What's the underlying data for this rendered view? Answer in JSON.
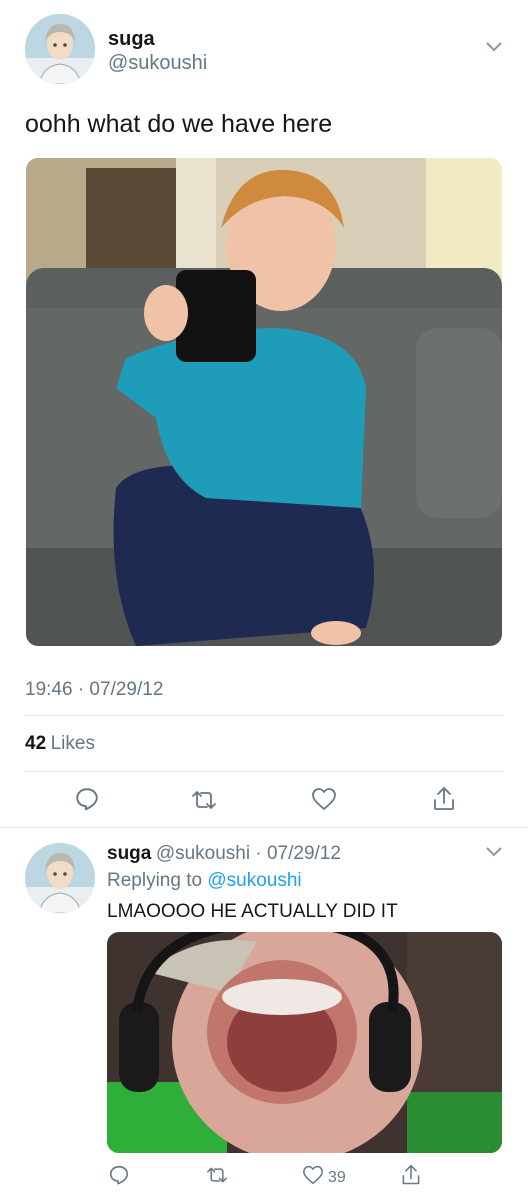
{
  "main_tweet": {
    "display_name": "suga",
    "handle": "@sukoushi",
    "text": "oohh what do we have here",
    "timestamp": "19:46 · 07/29/12",
    "likes_count": "42",
    "likes_label": "Likes",
    "photo_alt": "kid-with-mug-photo"
  },
  "reply_tweet": {
    "display_name": "suga",
    "handle": "@sukoushi",
    "date": "07/29/12",
    "replying_prefix": "Replying to",
    "replying_to": "@sukoushi",
    "text": "LMAOOOO HE ACTUALLY DID IT",
    "like_count": "39",
    "photo_alt": "screaming-face-photo"
  },
  "icons": [
    "avatar",
    "chevron-down-icon",
    "reply-icon",
    "retweet-icon",
    "like-icon",
    "share-icon"
  ],
  "colors": {
    "link": "#1da1f2",
    "secondary": "#657786",
    "divider": "#e1e8ed"
  }
}
